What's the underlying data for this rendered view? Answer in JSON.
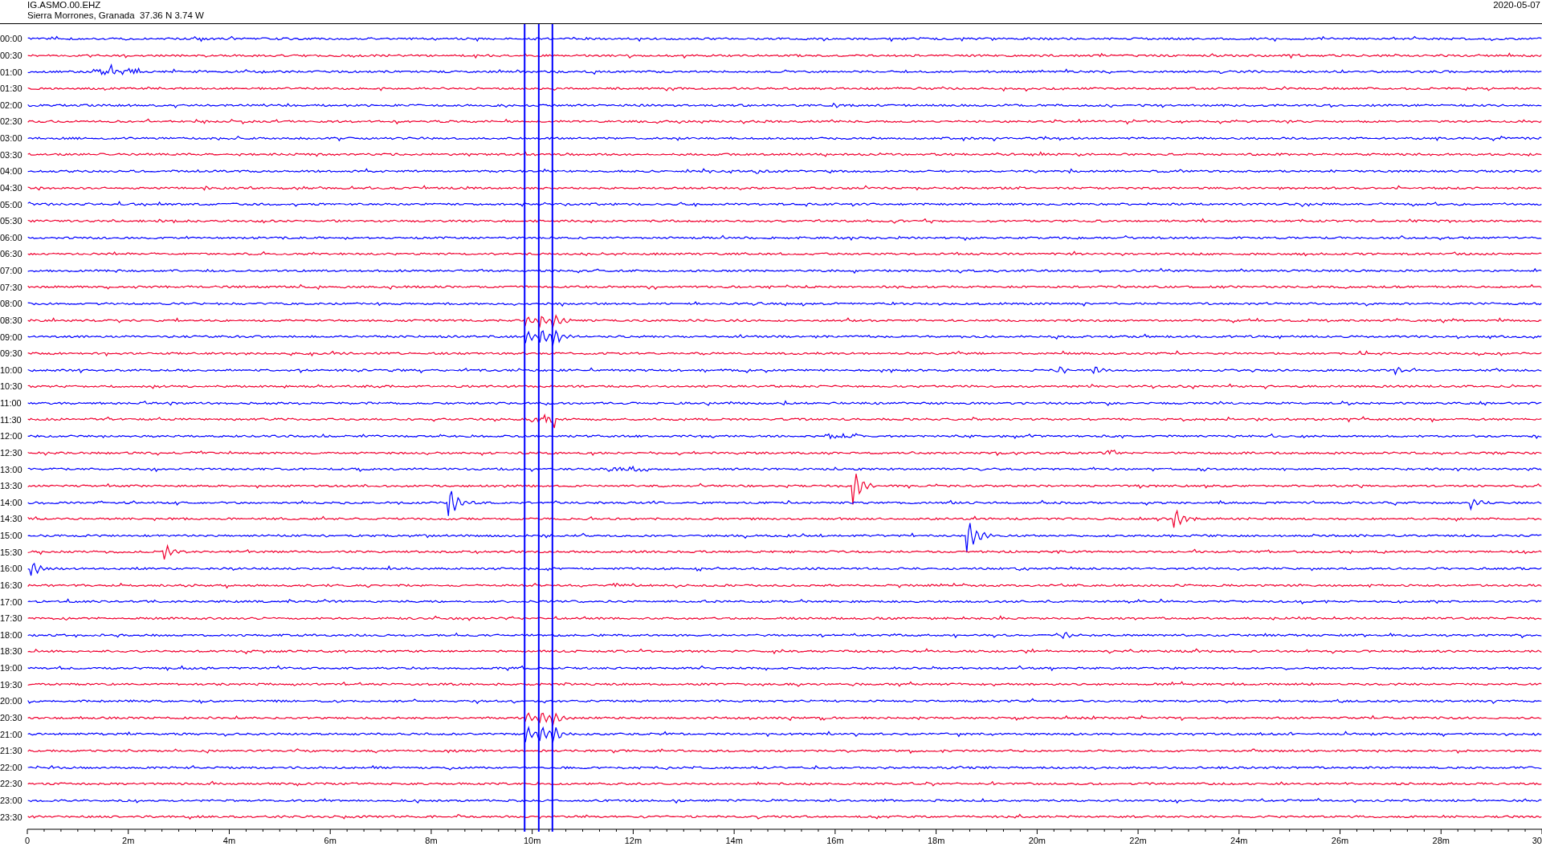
{
  "header": {
    "station": "IG.ASMO.00.EHZ",
    "location": "Sierra Morrones, Granada  37.36 N 3.74 W",
    "date": "2020-05-07"
  },
  "rows": [
    {
      "label": "00:00",
      "color": "#0000ff"
    },
    {
      "label": "00:30",
      "color": "#f00030"
    },
    {
      "label": "01:00",
      "color": "#0000ff"
    },
    {
      "label": "01:30",
      "color": "#f00030"
    },
    {
      "label": "02:00",
      "color": "#0000ff"
    },
    {
      "label": "02:30",
      "color": "#f00030"
    },
    {
      "label": "03:00",
      "color": "#0000ff"
    },
    {
      "label": "03:30",
      "color": "#f00030"
    },
    {
      "label": "04:00",
      "color": "#0000ff"
    },
    {
      "label": "04:30",
      "color": "#f00030"
    },
    {
      "label": "05:00",
      "color": "#0000ff"
    },
    {
      "label": "05:30",
      "color": "#f00030"
    },
    {
      "label": "06:00",
      "color": "#0000ff"
    },
    {
      "label": "06:30",
      "color": "#f00030"
    },
    {
      "label": "07:00",
      "color": "#0000ff"
    },
    {
      "label": "07:30",
      "color": "#f00030"
    },
    {
      "label": "08:00",
      "color": "#0000ff"
    },
    {
      "label": "08:30",
      "color": "#f00030"
    },
    {
      "label": "09:00",
      "color": "#0000ff"
    },
    {
      "label": "09:30",
      "color": "#f00030"
    },
    {
      "label": "10:00",
      "color": "#0000ff"
    },
    {
      "label": "10:30",
      "color": "#f00030"
    },
    {
      "label": "11:00",
      "color": "#0000ff"
    },
    {
      "label": "11:30",
      "color": "#f00030"
    },
    {
      "label": "12:00",
      "color": "#0000ff"
    },
    {
      "label": "12:30",
      "color": "#f00030"
    },
    {
      "label": "13:00",
      "color": "#0000ff"
    },
    {
      "label": "13:30",
      "color": "#f00030"
    },
    {
      "label": "14:00",
      "color": "#0000ff"
    },
    {
      "label": "14:30",
      "color": "#f00030"
    },
    {
      "label": "15:00",
      "color": "#0000ff"
    },
    {
      "label": "15:30",
      "color": "#f00030"
    },
    {
      "label": "16:00",
      "color": "#0000ff"
    },
    {
      "label": "16:30",
      "color": "#f00030"
    },
    {
      "label": "17:00",
      "color": "#0000ff"
    },
    {
      "label": "17:30",
      "color": "#f00030"
    },
    {
      "label": "18:00",
      "color": "#0000ff"
    },
    {
      "label": "18:30",
      "color": "#f00030"
    },
    {
      "label": "19:00",
      "color": "#0000ff"
    },
    {
      "label": "19:30",
      "color": "#f00030"
    },
    {
      "label": "20:00",
      "color": "#0000ff"
    },
    {
      "label": "20:30",
      "color": "#f00030"
    },
    {
      "label": "21:00",
      "color": "#0000ff"
    },
    {
      "label": "21:30",
      "color": "#f00030"
    },
    {
      "label": "22:00",
      "color": "#0000ff"
    },
    {
      "label": "22:30",
      "color": "#f00030"
    },
    {
      "label": "23:00",
      "color": "#0000ff"
    },
    {
      "label": "23:30",
      "color": "#f00030"
    }
  ],
  "axis": {
    "ticks": [
      "0",
      "2m",
      "4m",
      "6m",
      "8m",
      "10m",
      "12m",
      "14m",
      "16m",
      "18m",
      "20m",
      "22m",
      "24m",
      "26m",
      "28m",
      "30"
    ]
  }
}
